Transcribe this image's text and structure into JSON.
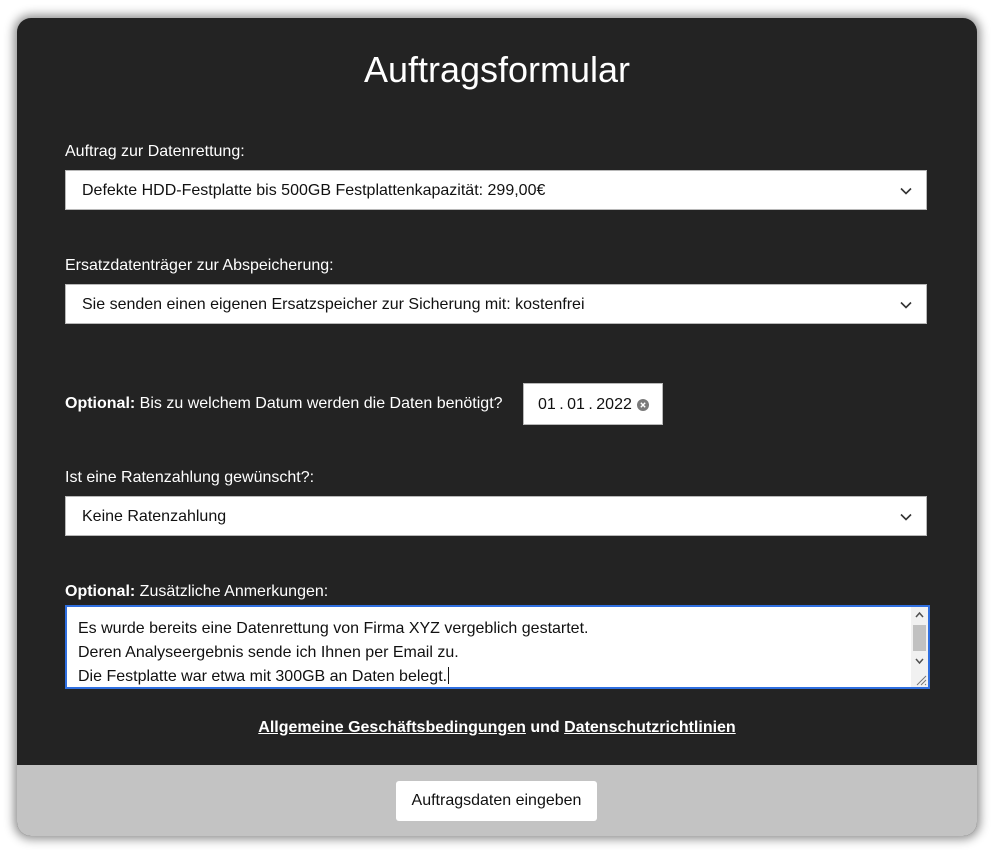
{
  "form": {
    "title": "Auftragsformular",
    "recovery": {
      "label": "Auftrag zur Datenrettung:",
      "selected": "Defekte HDD-Festplatte bis 500GB Festplattenkapazität: 299,00€"
    },
    "replacement": {
      "label": "Ersatzdatenträger zur Abspeicherung:",
      "selected": "Sie senden einen eigenen Ersatzspeicher zur Sicherung mit: kostenfrei"
    },
    "deadline": {
      "optional_prefix": "Optional:",
      "label": "Bis zu welchem Datum werden die Daten benötigt?",
      "value": "01 . 01 . 2022"
    },
    "installment": {
      "label": "Ist eine Ratenzahlung gewünscht?:",
      "selected": "Keine Ratenzahlung"
    },
    "notes": {
      "optional_prefix": "Optional:",
      "label": "Zusätzliche Anmerkungen:",
      "lines": [
        "Es wurde bereits eine Datenrettung von Firma XYZ vergeblich gestartet.",
        "Deren Analyseergebnis sende ich Ihnen per Email zu.",
        "Die Festplatte war etwa mit 300GB an Daten belegt."
      ]
    },
    "legal": {
      "terms_link": "Allgemeine Geschäftsbedingungen",
      "conjunction": "und",
      "privacy_link": "Datenschutzrichtlinien"
    },
    "submit_label": "Auftragsdaten eingeben"
  },
  "icons": {
    "select_arrow": "chevron-down-icon",
    "date_clear": "clear-circle-icon",
    "scroll_up": "scroll-up-arrow-icon",
    "scroll_down": "scroll-down-arrow-icon",
    "resize": "resize-grip-icon"
  },
  "colors": {
    "card_background": "#232323",
    "footer_background": "#c3c3c3",
    "focus_border": "#2f6fe0"
  }
}
